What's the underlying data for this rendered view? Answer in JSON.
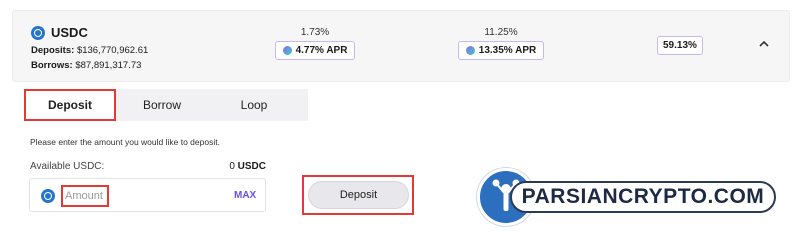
{
  "asset": {
    "name": "USDC",
    "icon": "usdc-coin-icon",
    "deposits_label": "Deposits:",
    "deposits_value": "$136,770,962.61",
    "borrows_label": "Borrows:",
    "borrows_value": "$87,891,317.73"
  },
  "rates": {
    "deposit_rate": "1.73%",
    "deposit_apr": "4.77% APR",
    "borrow_rate": "11.25%",
    "borrow_apr": "13.35% APR",
    "utilization": "59.13%"
  },
  "tabs": [
    {
      "label": "Deposit",
      "active": true
    },
    {
      "label": "Borrow",
      "active": false
    },
    {
      "label": "Loop",
      "active": false
    }
  ],
  "form": {
    "hint": "Please enter the amount you would like to deposit.",
    "available_label": "Available USDC:",
    "available_amount": "0",
    "available_unit": "USDC",
    "amount_placeholder": "Amount",
    "max_label": "MAX",
    "deposit_button": "Deposit"
  },
  "watermark": {
    "text": "PARSIANCRYPTO.COM"
  },
  "colors": {
    "accent": "#6b4fe6",
    "highlight_red": "#e53935",
    "usdc_blue": "#2775ca",
    "card_bg": "#f6f6f7"
  }
}
